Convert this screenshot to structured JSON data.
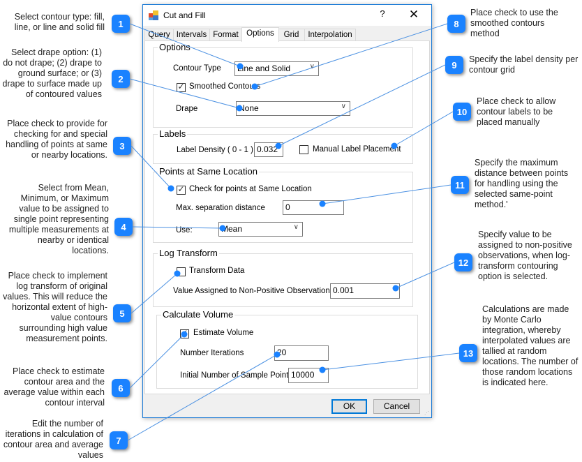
{
  "dialog": {
    "title": "Cut and Fill",
    "help_label": "?",
    "close_label": "✕",
    "tabs": [
      {
        "label": "Query"
      },
      {
        "label": "Intervals"
      },
      {
        "label": "Format"
      },
      {
        "label": "Options",
        "active": true
      },
      {
        "label": "Grid"
      },
      {
        "label": "Interpolation"
      }
    ],
    "options": {
      "group_title": "Options",
      "contour_type_label": "Contour Type",
      "contour_type_value": "Line and Solid",
      "smoothed_contours_label": "Smoothed Contours",
      "smoothed_contours_checked": true,
      "drape_label": "Drape",
      "drape_value": "None"
    },
    "labels": {
      "group_title": "Labels",
      "label_density_label": "Label Density ( 0 - 1 )",
      "label_density_value": "0.032",
      "manual_placement_label": "Manual Label Placement",
      "manual_placement_checked": false
    },
    "same_location": {
      "group_title": "Points at Same Location",
      "check_label": "Check for points at Same Location",
      "check_checked": true,
      "max_sep_label": "Max. separation distance",
      "max_sep_value": "0",
      "use_label": "Use:",
      "use_value": "Mean"
    },
    "log_transform": {
      "group_title": "Log Transform",
      "transform_label": "Transform Data",
      "transform_checked": false,
      "non_positive_label": "Value Assigned to Non-Positive Observations",
      "non_positive_value": "0.001"
    },
    "volume": {
      "group_title": "Calculate Volume",
      "estimate_label": "Estimate Volume",
      "estimate_checked": true,
      "iterations_label": "Number Iterations",
      "iterations_value": "20",
      "samples_label": "Initial Number of Sample Points",
      "samples_value": "10000"
    },
    "ok_label": "OK",
    "cancel_label": "Cancel"
  },
  "callouts": [
    {
      "num": "1",
      "text": "Select contour type: fill, line, or line and solid fill"
    },
    {
      "num": "2",
      "text": "Select drape option: (1) do not drape; (2) drape to ground surface; or (3) drape to surface made up of contoured values"
    },
    {
      "num": "3",
      "text": "Place check to provide for checking for and special handling of points at same or nearby locations."
    },
    {
      "num": "4",
      "text": "Select from Mean, Minimum, or Maximum value to be assigned to single point representing multiple measurements at nearby or identical locations."
    },
    {
      "num": "5",
      "text": "Place check to implement log transform of original values.  This will reduce the horizontal extent of high-value contours surrounding high value measurement points."
    },
    {
      "num": "6",
      "text": "Place check to estimate contour area and the average value within each contour interval"
    },
    {
      "num": "7",
      "text": "Edit the number of iterations in calculation of contour area and average values"
    },
    {
      "num": "8",
      "text": "Place check to use the smoothed contours method"
    },
    {
      "num": "9",
      "text": "Specify the label density per contour grid"
    },
    {
      "num": "10",
      "text": "Place check to allow contour labels to be placed manually"
    },
    {
      "num": "11",
      "text": "Specify the maximum distance between points for handling using the selected same-point method.'"
    },
    {
      "num": "12",
      "text": "Specify value to be assigned to non-positive observations, when log-transform contouring option is selected."
    },
    {
      "num": "13",
      "text": "Calculations are made by Monte Carlo integration, whereby interpolated values are tallied at random locations.  The number of those random locations is indicated here."
    }
  ],
  "colors": {
    "accent": "#1a82ff",
    "connector": "#4a90e2",
    "dialog_border": "#1a7ad6"
  }
}
